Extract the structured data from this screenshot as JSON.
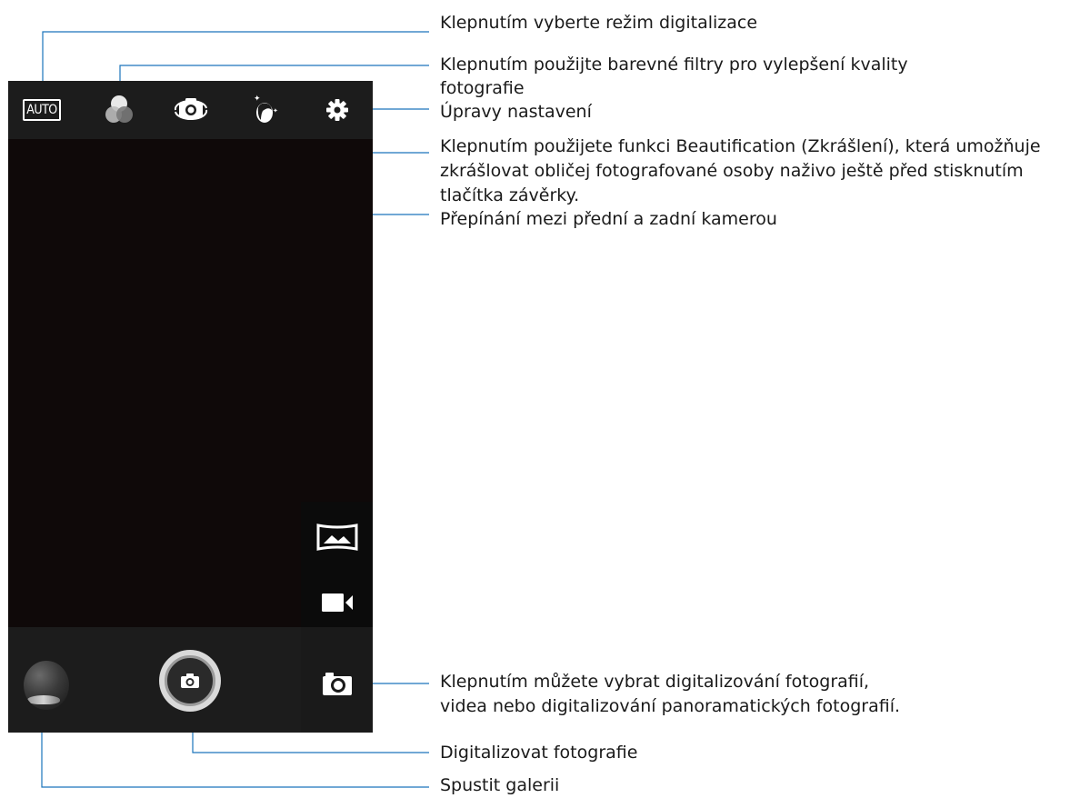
{
  "camera": {
    "topbar": {
      "mode_badge": "AUTO",
      "icons": [
        "auto-mode-icon",
        "color-filters-icon",
        "switch-camera-icon",
        "beautification-icon",
        "settings-gear-icon"
      ]
    },
    "side_modes": [
      "panorama-icon",
      "video-camera-icon",
      "photo-camera-icon"
    ],
    "selected_mode": "photo"
  },
  "callouts": {
    "scene_mode": "Klepnutím vyberte režim digitalizace",
    "filters_line1": "Klepnutím použijte barevné filtry pro vylepšení kvality",
    "filters_line2": "fotografie",
    "settings": "Úpravy nastavení",
    "beauty_line1": "Klepnutím použijete funkci Beautification (Zkrášlení), která umožňuje",
    "beauty_line2": "zkrášlovat obličej fotografované osoby naživo ještě před stisknutím",
    "beauty_line3": "tlačítka závěrky.",
    "switch_camera": "Přepínání mezi přední a zadní kamerou",
    "capture_mode_line1": "Klepnutím můžete vybrat digitalizování fotografií,",
    "capture_mode_line2": "videa nebo digitalizování panoramatických fotografií.",
    "shutter": "Digitalizovat fotografie",
    "gallery": "Spustit galerii"
  },
  "colors": {
    "callout_line": "#1c75bc",
    "screen_bg": "#0f0909",
    "bar_bg": "#1c1c1c"
  }
}
